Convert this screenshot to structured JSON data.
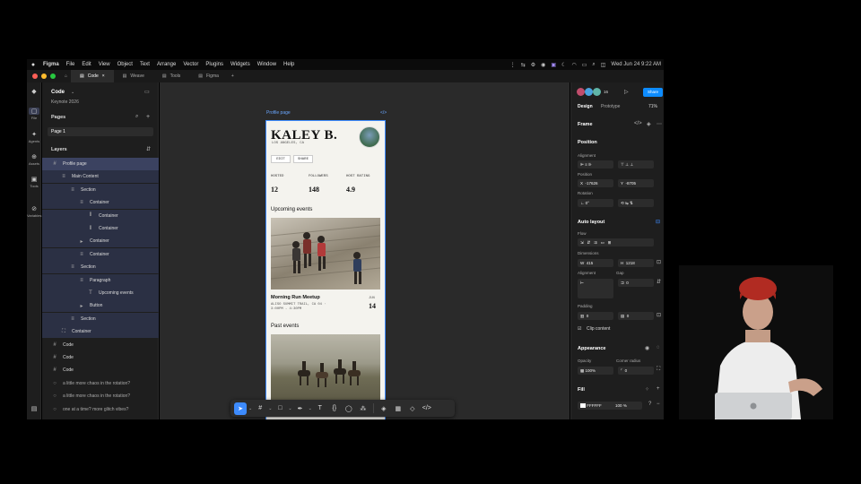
{
  "menubar": {
    "apple": "",
    "items": [
      "Figma",
      "File",
      "Edit",
      "View",
      "Object",
      "Text",
      "Arrange",
      "Vector",
      "Plugins",
      "Widgets",
      "Window",
      "Help"
    ],
    "datetime": "Wed Jun 24  9:22 AM"
  },
  "tabs": [
    {
      "label": "Code",
      "active": true
    },
    {
      "label": "Weave",
      "active": false
    },
    {
      "label": "Tools",
      "active": false
    },
    {
      "label": "Figma",
      "active": false
    }
  ],
  "rail": [
    "File",
    "Agents",
    "Assets",
    "Tools",
    "Variables"
  ],
  "left_panel": {
    "file_title": "Code",
    "file_subtitle": "Keynote 2026",
    "pages_heading": "Pages",
    "page": "Page 1",
    "layers_heading": "Layers",
    "layers": [
      {
        "label": "Profile page",
        "indent": 0,
        "icon": "#",
        "style": "sel-top"
      },
      {
        "label": "Main Content",
        "indent": 1,
        "icon": "≡",
        "style": "hl"
      },
      {
        "label": "Section",
        "indent": 2,
        "icon": "≡",
        "style": "hl"
      },
      {
        "label": "Container",
        "indent": 3,
        "icon": "≡",
        "style": "hl"
      },
      {
        "label": "Container",
        "indent": 4,
        "icon": "⦀",
        "style": "hl"
      },
      {
        "label": "Container",
        "indent": 4,
        "icon": "⦀",
        "style": "hl"
      },
      {
        "label": "Container",
        "indent": 3,
        "icon": "▸",
        "style": "hl"
      },
      {
        "label": "Container",
        "indent": 3,
        "icon": "≡",
        "style": "hl"
      },
      {
        "label": "Section",
        "indent": 2,
        "icon": "≡",
        "style": "hl"
      },
      {
        "label": "Paragraph",
        "indent": 3,
        "icon": "≡",
        "style": "hl"
      },
      {
        "label": "Upcoming events",
        "indent": 4,
        "icon": "T",
        "style": "hl"
      },
      {
        "label": "Button",
        "indent": 3,
        "icon": "▸",
        "style": "hl"
      },
      {
        "label": "Section",
        "indent": 2,
        "icon": "≡",
        "style": "hl"
      },
      {
        "label": "Container",
        "indent": 1,
        "icon": "⛶",
        "style": "hl"
      },
      {
        "label": "Code",
        "indent": 0,
        "icon": "#",
        "style": ""
      },
      {
        "label": "Code",
        "indent": 0,
        "icon": "#",
        "style": ""
      },
      {
        "label": "Code",
        "indent": 0,
        "icon": "#",
        "style": ""
      },
      {
        "label": "a little more chaos in the rotation?",
        "indent": 0,
        "icon": "○",
        "style": ""
      },
      {
        "label": "a little more chaos in the rotation?",
        "indent": 0,
        "icon": "○",
        "style": ""
      },
      {
        "label": "one at a time? more glitch vibes?",
        "indent": 0,
        "icon": "○",
        "style": ""
      }
    ]
  },
  "canvas": {
    "frame_label": "Profile page",
    "profile": {
      "name": "KALEY B.",
      "location": "LOS ANGELES, CA",
      "edit": "EDIT",
      "share": "SHARE",
      "stats": [
        {
          "label": "HOSTED",
          "value": "12"
        },
        {
          "label": "FOLLOWERS",
          "value": "148"
        },
        {
          "label": "HOST RATING",
          "value": "4.9"
        }
      ],
      "upcoming_heading": "Upcoming events",
      "event_title": "Morning Run Meetup",
      "event_sub": "ALISO SUMMIT TRAIL, CA 04 · 3:00PM - 4:30PM",
      "event_month": "JUN",
      "event_day": "14",
      "past_heading": "Past events"
    }
  },
  "toolbar": [
    "move-tool",
    "frame-tool",
    "shape-tool",
    "pen-tool",
    "text-tool",
    "code-tool",
    "comment-tool",
    "actions-tool"
  ],
  "right_panel": {
    "zoom_user_count": "16",
    "share": "Share",
    "tab_design": "Design",
    "tab_prototype": "Prototype",
    "zoom": "71%",
    "frame": "Frame",
    "position": "Position",
    "alignment": "Alignment",
    "position_label": "Position",
    "x": "-17626",
    "y": "-8705",
    "rotation_label": "Rotation",
    "rotation": "0°",
    "auto_layout": "Auto layout",
    "flow": "Flow",
    "dimensions": "Dimensions",
    "w": "415",
    "h": "1218",
    "al_alignment": "Alignment",
    "gap_label": "Gap",
    "gap": "0",
    "padding_label": "Padding",
    "pad_h": "0",
    "pad_v": "0",
    "clip": "Clip content",
    "appearance": "Appearance",
    "opacity_label": "Opacity",
    "opacity": "100%",
    "radius_label": "Corner radius",
    "radius": "0",
    "fill": "Fill",
    "fill_hex": "FFFFFF",
    "fill_opacity": "100",
    "fill_pct": "%"
  },
  "colors": {
    "accent": "#3d8bfd",
    "share": "#0d8cff"
  }
}
